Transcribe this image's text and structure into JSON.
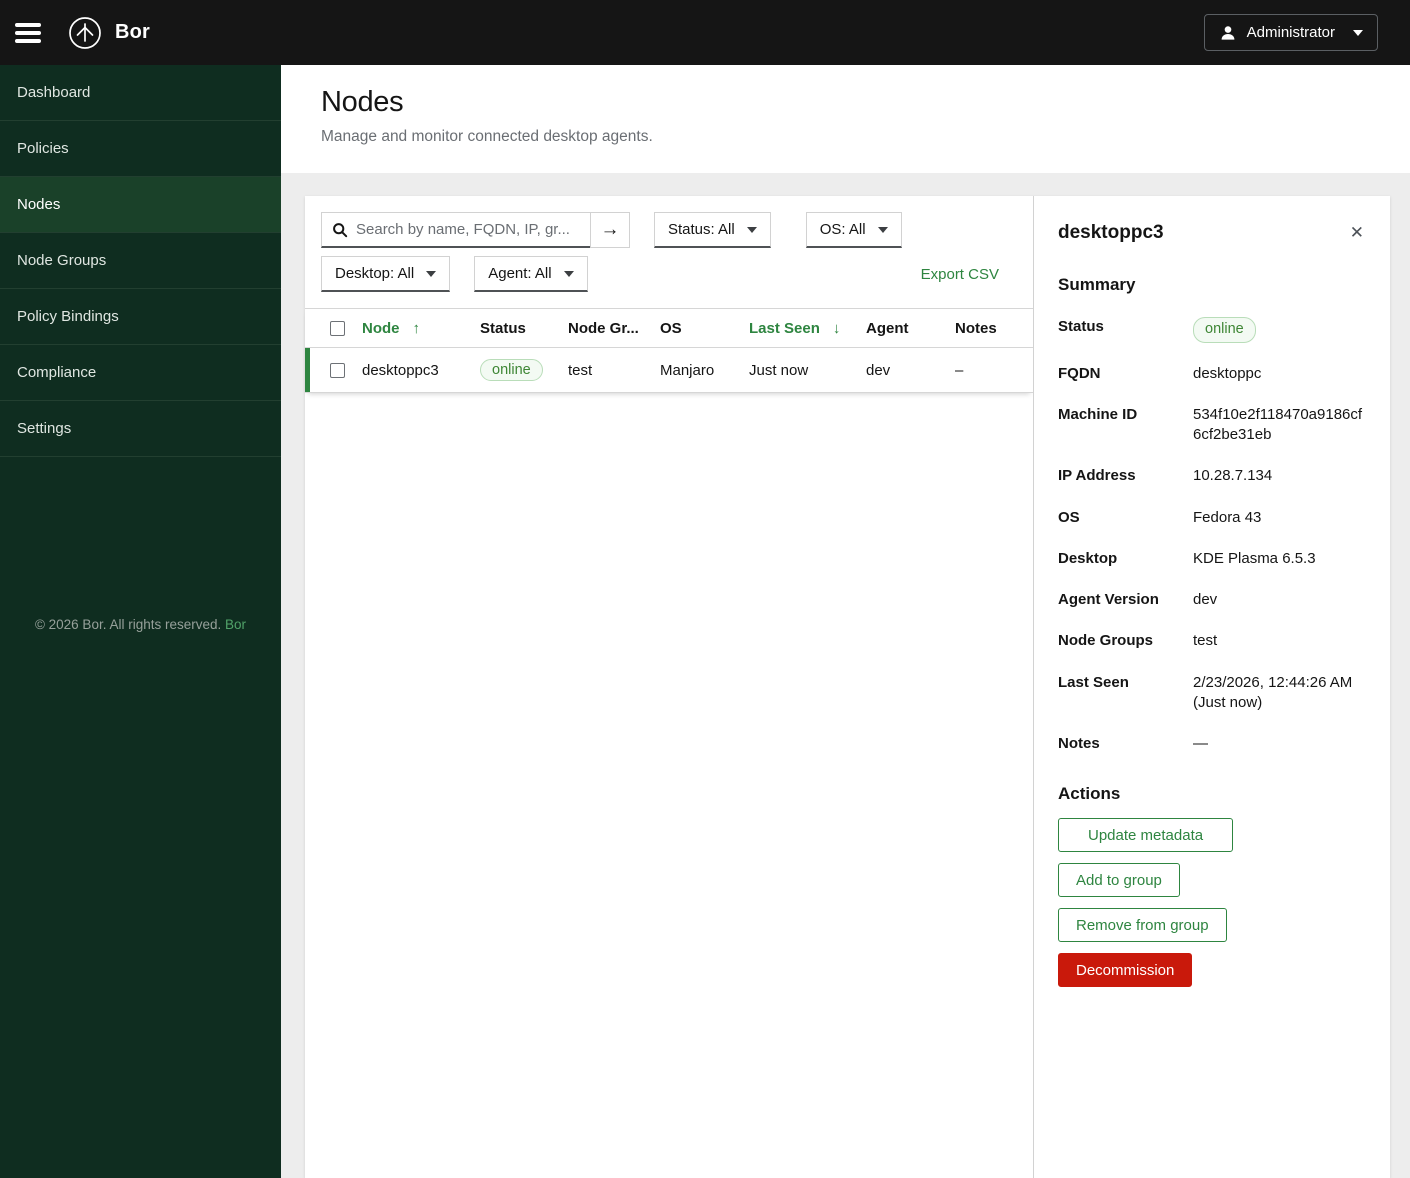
{
  "topbar": {
    "brand": "Bor",
    "user_label": "Administrator"
  },
  "sidebar": {
    "items": [
      {
        "label": "Dashboard"
      },
      {
        "label": "Policies"
      },
      {
        "label": "Nodes"
      },
      {
        "label": "Node Groups"
      },
      {
        "label": "Policy Bindings"
      },
      {
        "label": "Compliance"
      },
      {
        "label": "Settings"
      }
    ],
    "active_item": "Nodes",
    "footer": {
      "text": "© 2026 Bor. All rights reserved.",
      "link_label": "Bor"
    }
  },
  "page": {
    "title": "Nodes",
    "subtitle": "Manage and monitor connected desktop agents."
  },
  "toolbar": {
    "search": {
      "placeholder": "Search by name, FQDN, IP, gr...",
      "value": ""
    },
    "filters": [
      {
        "label": "Status: All"
      },
      {
        "label": "OS: All"
      },
      {
        "label": "Desktop: All"
      },
      {
        "label": "Agent: All"
      }
    ],
    "export_label": "Export CSV"
  },
  "table": {
    "columns": [
      {
        "label": "Node",
        "sorted": "asc"
      },
      {
        "label": "Status",
        "sorted": "none"
      },
      {
        "label": "Node Gr...",
        "sorted": "none"
      },
      {
        "label": "OS",
        "sorted": "none"
      },
      {
        "label": "Last Seen",
        "sorted": "desc"
      },
      {
        "label": "Agent",
        "sorted": "none"
      },
      {
        "label": "Notes",
        "sorted": "none"
      }
    ],
    "rows": [
      {
        "node": "desktoppc3",
        "status": "online",
        "node_group": "test",
        "os": "Manjaro",
        "last_seen": "Just now",
        "agent": "dev",
        "notes": "–",
        "selected": true
      }
    ]
  },
  "detail": {
    "title": "desktoppc3",
    "summary_heading": "Summary",
    "fields": [
      {
        "label": "Status",
        "value": "online"
      },
      {
        "label": "FQDN",
        "value": "desktoppc"
      },
      {
        "label": "Machine ID",
        "value": "534f10e2f118470a9186cf6cf2be31eb"
      },
      {
        "label": "IP Address",
        "value": "10.28.7.134"
      },
      {
        "label": "OS",
        "value": "Fedora 43"
      },
      {
        "label": "Desktop",
        "value": "KDE Plasma 6.5.3"
      },
      {
        "label": "Agent Version",
        "value": "dev"
      },
      {
        "label": "Node Groups",
        "value": "test"
      },
      {
        "label": "Last Seen",
        "value": "2/23/2026, 12:44:26 AM (Just now)"
      },
      {
        "label": "Notes",
        "value": "—"
      }
    ],
    "actions_heading": "Actions",
    "actions": [
      {
        "label": "Update metadata",
        "variant": "secondary"
      },
      {
        "label": "Add to group",
        "variant": "secondary"
      },
      {
        "label": "Remove from group",
        "variant": "secondary"
      },
      {
        "label": "Decommission",
        "variant": "danger"
      }
    ]
  },
  "icons": {
    "sort_asc": "↑",
    "sort_desc": "↓",
    "submit_arrow": "→",
    "close": "✕"
  },
  "colors": {
    "accent_green": "#2e8540",
    "danger_red": "#c9190b",
    "topbar_bg": "#151515",
    "sidebar_bg": "#0f2d20",
    "sidebar_active_bg": "#1a4129",
    "badge_bg": "#f3faf3",
    "badge_border": "#b9ddb9",
    "badge_text": "#3e8635",
    "page_bg": "#ededed"
  }
}
